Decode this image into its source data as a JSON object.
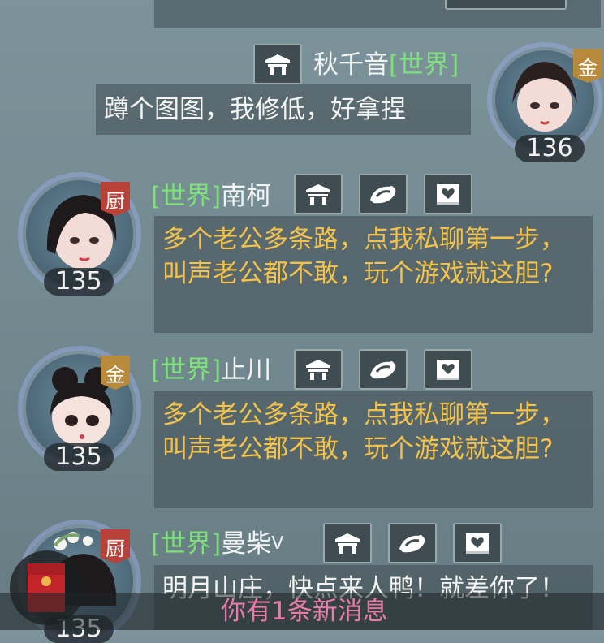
{
  "messages": [
    {
      "channel": "[世界]",
      "name": "秋千音",
      "text": "蹲个图图，我修低，好拿捏",
      "level": "136",
      "rank": "金",
      "badges": [
        "home-icon"
      ]
    },
    {
      "channel": "[世界]",
      "name": "南柯",
      "text": "多个老公多条路，点我私聊第一步，叫声老公都不敢，玩个游戏就这胆?",
      "level": "135",
      "rank": "厨",
      "badges": [
        "home-icon",
        "ribbon-icon",
        "heart-card-icon"
      ]
    },
    {
      "channel": "[世界]",
      "name": "止川",
      "text": "多个老公多条路，点我私聊第一步，叫声老公都不敢，玩个游戏就这胆?",
      "level": "135",
      "rank": "金",
      "badges": [
        "home-icon",
        "ribbon-icon",
        "heart-card-icon"
      ]
    },
    {
      "channel": "[世界]",
      "name": "曼柴",
      "name_suffix": "ᐯ",
      "text": "明月山庄，快点来人鸭！就差你了！",
      "level": "135",
      "rank": "厨",
      "badges": [
        "home-icon",
        "ribbon-icon",
        "heart-card-icon"
      ]
    }
  ],
  "notification": {
    "text": "你有1条新消息"
  },
  "colors": {
    "channel": "#7ee07a",
    "message_yellow": "#f2c24a",
    "notification": "#ea7aa8"
  }
}
